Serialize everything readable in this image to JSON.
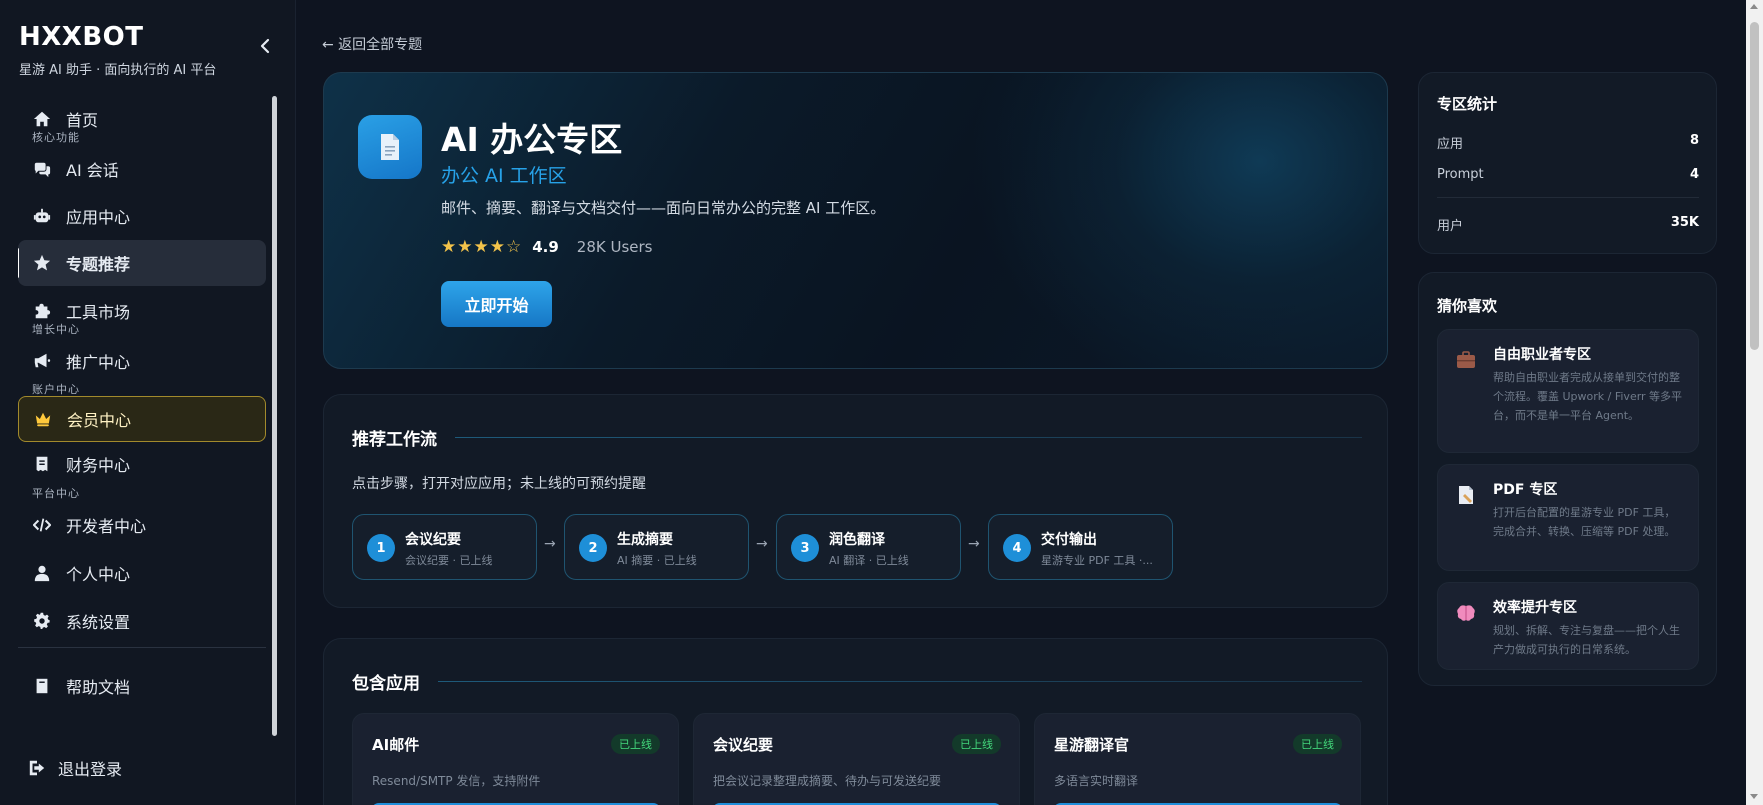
{
  "brand": {
    "name": "HXXBOT",
    "tagline": "星游 AI 助手 · 面向执行的 AI 平台"
  },
  "sidebar": {
    "items": [
      {
        "label": "首页",
        "icon": "home-icon"
      },
      {
        "label": "AI 会话",
        "icon": "chat-icon"
      },
      {
        "label": "应用中心",
        "icon": "robot-icon"
      },
      {
        "label": "专题推荐",
        "icon": "star-icon"
      },
      {
        "label": "工具市场",
        "icon": "puzzle-icon"
      },
      {
        "label": "推广中心",
        "icon": "megaphone-icon"
      },
      {
        "label": "会员中心",
        "icon": "crown-icon"
      },
      {
        "label": "财务中心",
        "icon": "receipt-icon"
      },
      {
        "label": "开发者中心",
        "icon": "code-icon"
      },
      {
        "label": "个人中心",
        "icon": "user-icon"
      },
      {
        "label": "系统设置",
        "icon": "gear-icon"
      },
      {
        "label": "帮助文档",
        "icon": "book-icon"
      }
    ],
    "groups": [
      "核心功能",
      "增长中心",
      "账户中心",
      "平台中心"
    ],
    "logout": "退出登录"
  },
  "main": {
    "back": "← 返回全部专题",
    "hero": {
      "title": "AI 办公专区",
      "subtitle": "办公 AI 工作区",
      "description": "邮件、摘要、翻译与文档交付——面向日常办公的完整 AI 工作区。",
      "stars": "★★★★☆",
      "rating": "4.9",
      "users": "28K Users",
      "cta": "立即开始"
    },
    "workflow": {
      "title": "推荐工作流",
      "description": "点击步骤，打开对应应用；未上线的可预约提醒",
      "arrow": "→",
      "steps": [
        {
          "num": "1",
          "title": "会议纪要",
          "sub": "会议纪要 · 已上线"
        },
        {
          "num": "2",
          "title": "生成摘要",
          "sub": "AI 摘要 · 已上线"
        },
        {
          "num": "3",
          "title": "润色翻译",
          "sub": "AI 翻译 · 已上线"
        },
        {
          "num": "4",
          "title": "交付输出",
          "sub": "星游专业 PDF 工具 ·..."
        }
      ]
    },
    "apps": {
      "title": "包含应用",
      "items": [
        {
          "name": "AI邮件",
          "status": "已上线",
          "desc": "Resend/SMTP 发信，支持附件"
        },
        {
          "name": "会议纪要",
          "status": "已上线",
          "desc": "把会议记录整理成摘要、待办与可发送纪要"
        },
        {
          "name": "星游翻译官",
          "status": "已上线",
          "desc": "多语言实时翻译"
        }
      ]
    }
  },
  "stats": {
    "title": "专区统计",
    "rows": [
      {
        "k": "应用",
        "v": "8"
      },
      {
        "k": "Prompt",
        "v": "4"
      },
      {
        "k": "用户",
        "v": "35K"
      }
    ]
  },
  "recommend": {
    "title": "猜你喜欢",
    "items": [
      {
        "title": "自由职业者专区",
        "desc": "帮助自由职业者完成从接单到交付的整个流程。覆盖 Upwork / Fiverr 等多平台，而不是单一平台 Agent。",
        "icon": "briefcase-icon"
      },
      {
        "title": "PDF 专区",
        "desc": "打开后台配置的星游专业 PDF 工具，完成合并、转换、压缩等 PDF 处理。",
        "icon": "document-icon"
      },
      {
        "title": "效率提升专区",
        "desc": "规划、拆解、专注与复盘——把个人生产力做成可执行的日常系统。",
        "icon": "brain-icon"
      }
    ]
  },
  "colors": {
    "accent": "#1f8fdb",
    "vip": "#a28a2c",
    "online": "#43d67b"
  }
}
